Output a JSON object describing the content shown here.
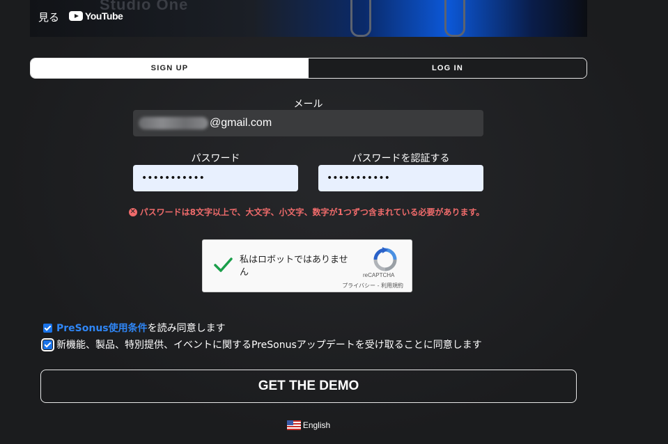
{
  "video": {
    "brand_text": "Studio One",
    "watch_label": "見る",
    "youtube_label": "YouTube"
  },
  "tabs": [
    {
      "label": "SIGN UP",
      "active": true
    },
    {
      "label": "LOG IN",
      "active": false
    }
  ],
  "form": {
    "email_label": "メール",
    "email_value_visible": "@gmail.com",
    "password_label": "パスワード",
    "password_value": "•••••••••••",
    "confirm_label": "パスワードを認証する",
    "confirm_value": "•••••••••••",
    "error_message": "パスワードは8文字以上で、大文字、小文字、数字が1つずつ含まれている必要があります。"
  },
  "recaptcha": {
    "text": "私はロボットではありません",
    "brand": "reCAPTCHA",
    "links": "プライバシー - 利用規約",
    "checked": true
  },
  "consents": [
    {
      "link": "PreSonus使用条件",
      "text": "を読み同意します",
      "checked": true
    },
    {
      "text": "新機能、製品、特別提供、イベントに関するPreSonusアップデートを受け取ることに同意します",
      "checked": true
    }
  ],
  "submit_label": "GET THE DEMO",
  "language": "English",
  "colors": {
    "background": "#1e1f21",
    "accent_link": "#2f86f6",
    "error": "#ef6b6b",
    "checkbox": "#1a73e8",
    "input_fill": "#e8f0fe"
  },
  "icons": [
    "youtube-icon",
    "error-icon",
    "recaptcha-checkmark-icon",
    "recaptcha-logo-icon",
    "us-flag-icon"
  ]
}
